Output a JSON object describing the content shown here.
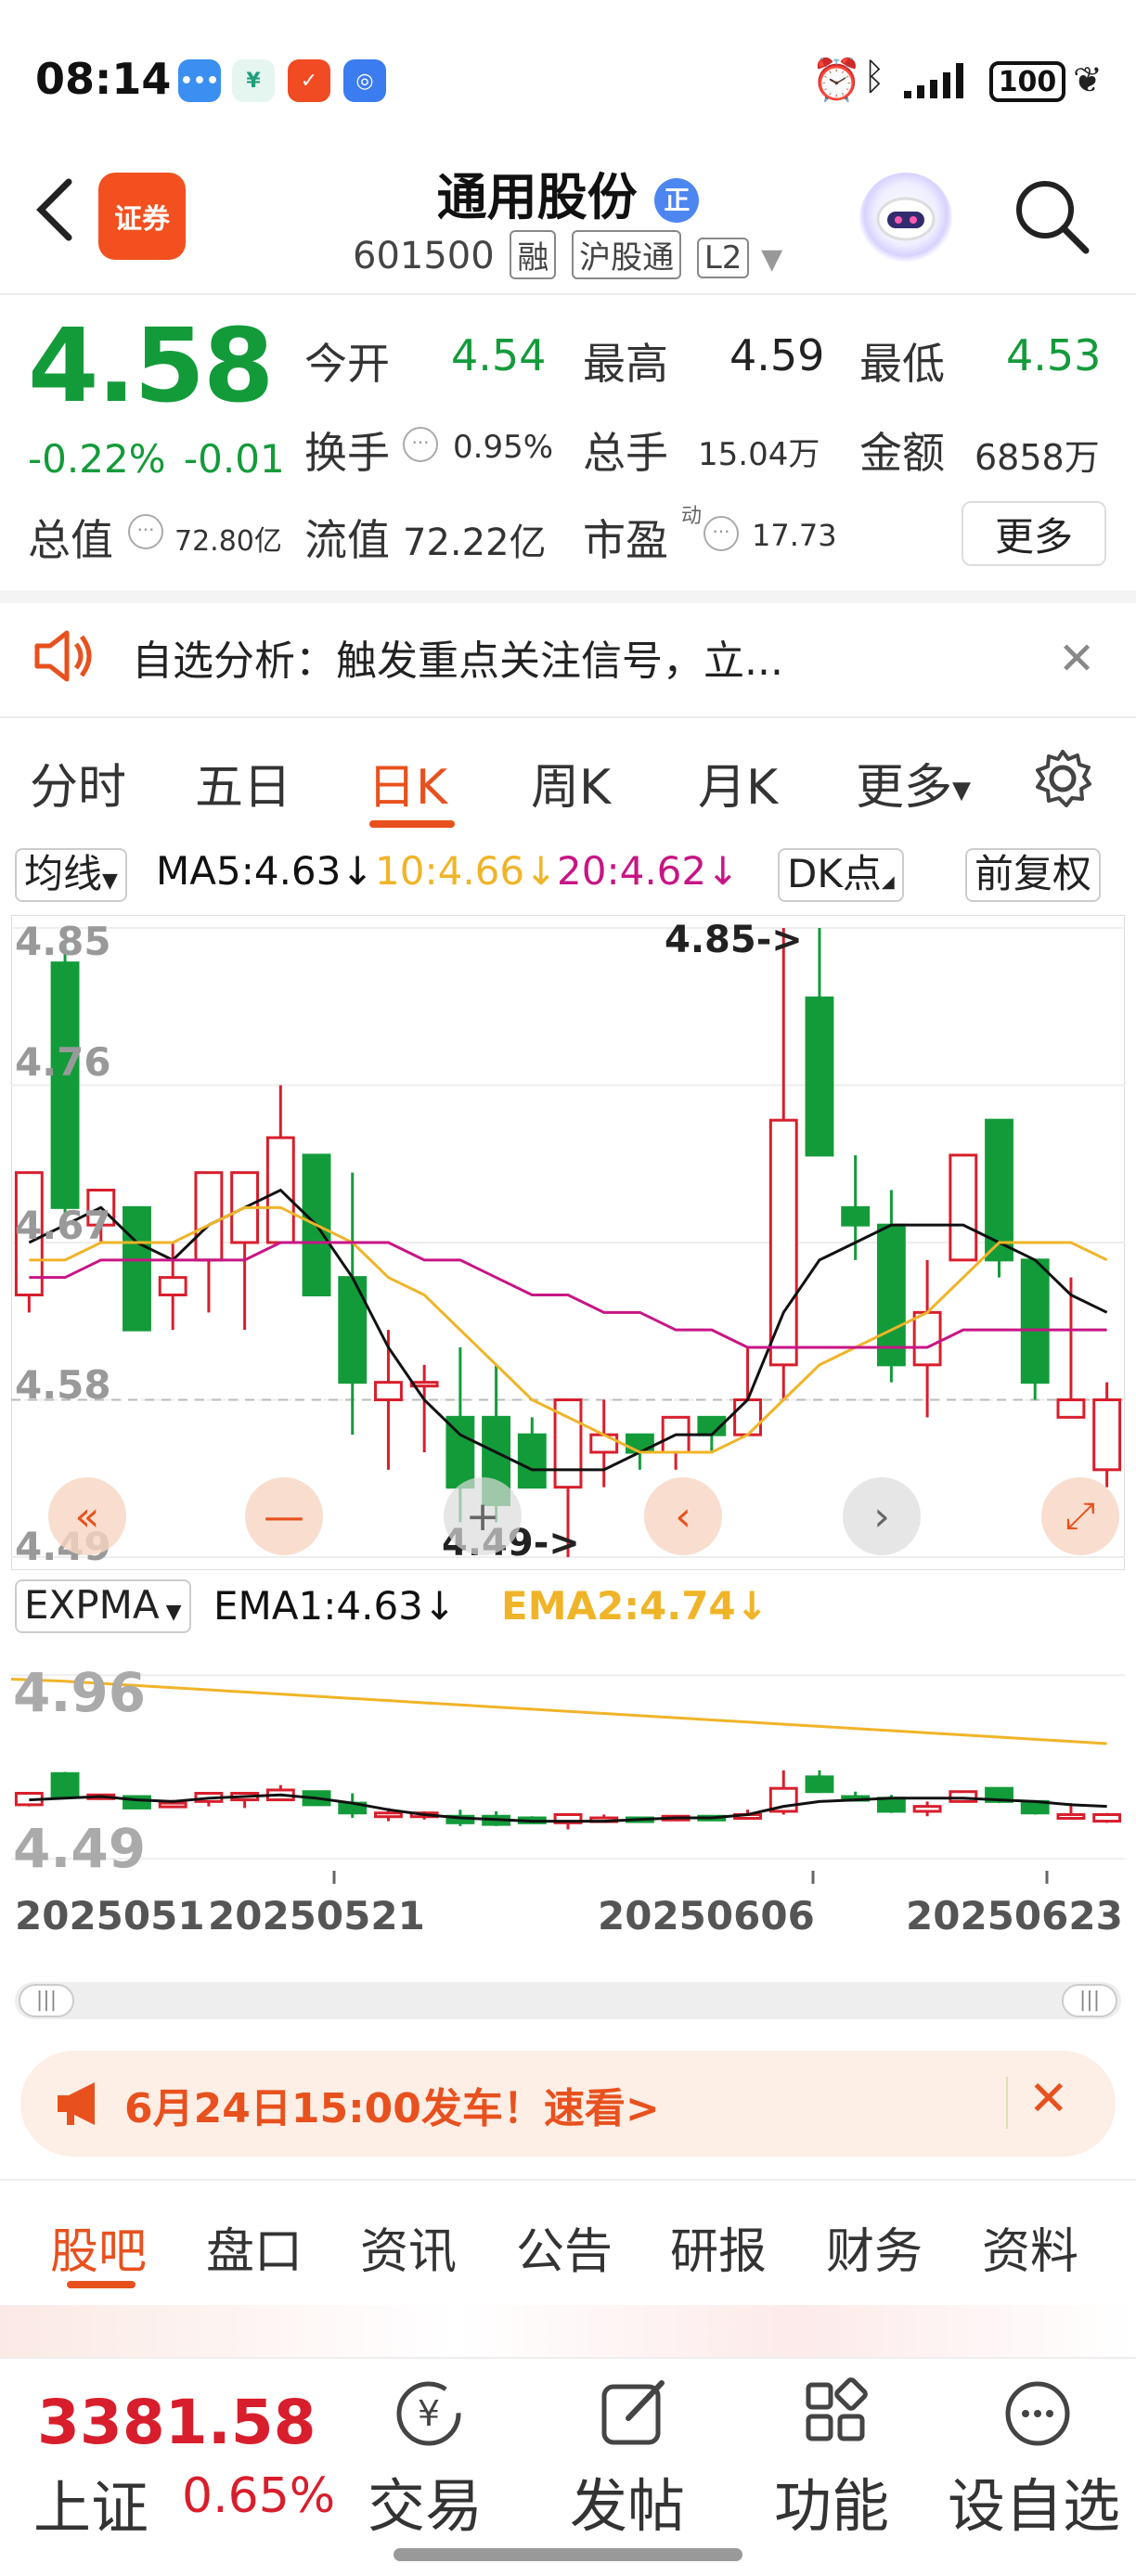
{
  "status": {
    "time": "08:14",
    "battery": "100"
  },
  "header": {
    "title": "通用股份",
    "badge": "正",
    "code": "601500",
    "tags": [
      "融",
      "沪股通",
      "L2"
    ],
    "app_badge": "证券"
  },
  "quote": {
    "price": "4.58",
    "pct": "-0.22%",
    "chg": "-0.01",
    "open_label": "今开",
    "open": "4.54",
    "high_label": "最高",
    "high": "4.59",
    "low_label": "最低",
    "low": "4.53",
    "turnover_label": "换手",
    "turnover": "0.95%",
    "volume_label": "总手",
    "volume": "15.04万",
    "amount_label": "金额",
    "amount": "6858万",
    "mcap_label": "总值",
    "mcap": "72.80亿",
    "float_label": "流值",
    "float": "72.22亿",
    "pe_label": "市盈",
    "pe_sup": "动",
    "pe": "17.73",
    "more": "更多"
  },
  "notice": {
    "text": "自选分析：触发重点关注信号，立..."
  },
  "period_tabs": [
    "分时",
    "五日",
    "日K",
    "周K",
    "月K",
    "更多"
  ],
  "ma": {
    "selector": "均线",
    "ma5": "MA5:4.63↓",
    "ma10": "10:4.66↓",
    "ma20": "20:4.62↓",
    "dk": "DK点",
    "adj": "前复权"
  },
  "colors": {
    "up": "#d81e2c",
    "down": "#139b3a",
    "ma5": "#111111",
    "ma10": "#f0b428",
    "ma20": "#c71585",
    "accent": "#e8511e"
  },
  "kchart": {
    "y_labels": [
      "4.85",
      "4.76",
      "4.67",
      "4.58",
      "4.49"
    ],
    "hi_note": "4.85->",
    "lo_note": "4.49->"
  },
  "expma": {
    "selector": "EXPMA",
    "ema1": "EMA1:4.63↓",
    "ema2": "EMA2:4.74↓",
    "y_labels": [
      "4.96",
      "4.49"
    ]
  },
  "x_dates": [
    "20250512",
    "20250521",
    "20250606",
    "20250623"
  ],
  "chart_data": {
    "type": "candlestick",
    "price_range": [
      4.49,
      4.85
    ],
    "candles": [
      [
        4.64,
        4.71,
        4.71,
        4.63
      ],
      [
        4.83,
        4.69,
        4.84,
        4.68
      ],
      [
        4.68,
        4.7,
        4.7,
        4.67
      ],
      [
        4.69,
        4.62,
        4.69,
        4.62
      ],
      [
        4.64,
        4.65,
        4.67,
        4.62
      ],
      [
        4.66,
        4.71,
        4.71,
        4.63
      ],
      [
        4.67,
        4.71,
        4.71,
        4.62
      ],
      [
        4.67,
        4.73,
        4.76,
        4.67
      ],
      [
        4.72,
        4.64,
        4.72,
        4.64
      ],
      [
        4.65,
        4.59,
        4.71,
        4.56
      ],
      [
        4.58,
        4.59,
        4.62,
        4.54
      ],
      [
        4.59,
        4.59,
        4.6,
        4.55
      ],
      [
        4.57,
        4.53,
        4.61,
        4.51
      ],
      [
        4.57,
        4.52,
        4.6,
        4.51
      ],
      [
        4.56,
        4.53,
        4.57,
        4.53
      ],
      [
        4.53,
        4.58,
        4.58,
        4.49
      ],
      [
        4.55,
        4.56,
        4.58,
        4.53
      ],
      [
        4.56,
        4.55,
        4.56,
        4.54
      ],
      [
        4.55,
        4.57,
        4.57,
        4.54
      ],
      [
        4.57,
        4.56,
        4.57,
        4.55
      ],
      [
        4.56,
        4.58,
        4.61,
        4.56
      ],
      [
        4.6,
        4.74,
        4.85,
        4.58
      ],
      [
        4.81,
        4.72,
        4.85,
        4.72
      ],
      [
        4.69,
        4.68,
        4.72,
        4.66
      ],
      [
        4.68,
        4.6,
        4.7,
        4.59
      ],
      [
        4.6,
        4.63,
        4.66,
        4.57
      ],
      [
        4.66,
        4.72,
        4.72,
        4.66
      ],
      [
        4.74,
        4.66,
        4.74,
        4.65
      ],
      [
        4.66,
        4.59,
        4.66,
        4.58
      ],
      [
        4.57,
        4.58,
        4.65,
        4.58
      ],
      [
        4.54,
        4.58,
        4.59,
        4.53
      ]
    ],
    "series": [
      {
        "name": "MA5",
        "values": [
          4.67,
          4.68,
          4.69,
          4.67,
          4.66,
          4.68,
          4.69,
          4.7,
          4.68,
          4.65,
          4.61,
          4.58,
          4.56,
          4.55,
          4.54,
          4.54,
          4.54,
          4.55,
          4.56,
          4.56,
          4.58,
          4.63,
          4.66,
          4.67,
          4.68,
          4.68,
          4.68,
          4.67,
          4.66,
          4.64,
          4.63
        ]
      },
      {
        "name": "10",
        "values": [
          4.66,
          4.66,
          4.67,
          4.67,
          4.67,
          4.68,
          4.69,
          4.69,
          4.68,
          4.67,
          4.65,
          4.64,
          4.62,
          4.6,
          4.58,
          4.57,
          4.56,
          4.55,
          4.55,
          4.55,
          4.56,
          4.58,
          4.6,
          4.61,
          4.62,
          4.63,
          4.65,
          4.67,
          4.67,
          4.67,
          4.66
        ]
      },
      {
        "name": "20",
        "values": [
          4.65,
          4.65,
          4.66,
          4.66,
          4.66,
          4.66,
          4.66,
          4.67,
          4.67,
          4.67,
          4.67,
          4.66,
          4.66,
          4.65,
          4.64,
          4.64,
          4.63,
          4.63,
          4.62,
          4.62,
          4.61,
          4.61,
          4.61,
          4.61,
          4.61,
          4.61,
          4.62,
          4.62,
          4.62,
          4.62,
          4.62
        ]
      }
    ]
  },
  "ad": {
    "text": "6月24日15:00发车！速看>"
  },
  "section_tabs": [
    "股吧",
    "盘口",
    "资讯",
    "公告",
    "研报",
    "财务",
    "资料"
  ],
  "index": {
    "value": "3381.58",
    "name": "上证",
    "pct": "0.65%"
  },
  "bottom_nav": [
    {
      "icon": "¥",
      "label": "交易"
    },
    {
      "icon": "✎",
      "label": "发帖"
    },
    {
      "icon": "▦",
      "label": "功能"
    },
    {
      "icon": "···",
      "label": "设自选"
    }
  ]
}
